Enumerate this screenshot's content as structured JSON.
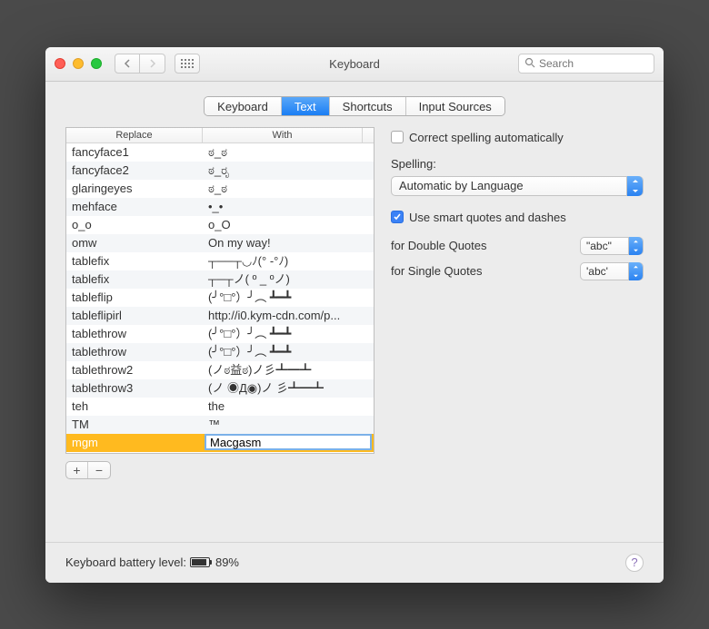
{
  "window": {
    "title": "Keyboard",
    "search_placeholder": "Search"
  },
  "tabs": {
    "items": [
      {
        "label": "Keyboard",
        "active": false
      },
      {
        "label": "Text",
        "active": true
      },
      {
        "label": "Shortcuts",
        "active": false
      },
      {
        "label": "Input Sources",
        "active": false
      }
    ]
  },
  "table": {
    "header_replace": "Replace",
    "header_with": "With",
    "rows": [
      {
        "replace": "fancyface1",
        "with": "ಠ_ಠ"
      },
      {
        "replace": "fancyface2",
        "with": "ಠ_ರೃ"
      },
      {
        "replace": "glaringeyes",
        "with": "ಠ_ಠ"
      },
      {
        "replace": "mehface",
        "with": "•_•"
      },
      {
        "replace": "o_o",
        "with": "o_O"
      },
      {
        "replace": "omw",
        "with": "On my way!"
      },
      {
        "replace": "tablefix",
        "with": "┬──┬◡ﾉ(° -°ﾉ)"
      },
      {
        "replace": "tablefix",
        "with": "┬─┬ノ( º _ ºノ)"
      },
      {
        "replace": "tableflip",
        "with": "(╯°□°）╯︵ ┻━┻"
      },
      {
        "replace": "tableflipirl",
        "with": "http://i0.kym-cdn.com/p..."
      },
      {
        "replace": "tablethrow",
        "with": "(╯°□°）╯︵ ┻━┻"
      },
      {
        "replace": "tablethrow",
        "with": "(╯°□°）╯︵ ┻━┻"
      },
      {
        "replace": "tablethrow2",
        "with": "(ノಠ益ಠ)ノ彡┻━┻"
      },
      {
        "replace": "tablethrow3",
        "with": "(ノ ◉Д◉)ノ 彡┻━┻"
      },
      {
        "replace": "teh",
        "with": "the"
      },
      {
        "replace": "TM",
        "with": "™"
      }
    ],
    "editing": {
      "replace": "mgm",
      "with": "Macgasm"
    }
  },
  "options": {
    "correct_spelling_label": "Correct spelling automatically",
    "correct_spelling_checked": false,
    "spelling_label": "Spelling:",
    "spelling_value": "Automatic by Language",
    "smart_quotes_label": "Use smart quotes and dashes",
    "smart_quotes_checked": true,
    "double_quotes_label": "for Double Quotes",
    "double_quotes_value": "\"abc\"",
    "single_quotes_label": "for Single Quotes",
    "single_quotes_value": "'abc'"
  },
  "footer": {
    "battery_label": "Keyboard battery level:",
    "battery_percent": "89%"
  }
}
